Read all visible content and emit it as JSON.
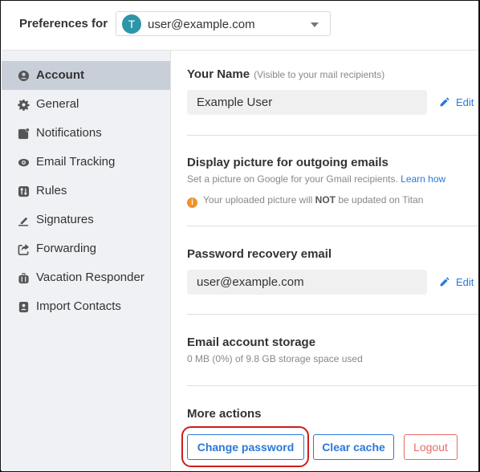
{
  "header": {
    "label": "Preferences for",
    "account": {
      "avatar_initial": "T",
      "email": "user@example.com",
      "avatar_color": "#2b96a8"
    }
  },
  "sidebar": {
    "items": [
      {
        "label": "Account",
        "icon": "user-circle-icon",
        "active": true
      },
      {
        "label": "General",
        "icon": "gear-icon",
        "active": false
      },
      {
        "label": "Notifications",
        "icon": "notification-icon",
        "active": false
      },
      {
        "label": "Email Tracking",
        "icon": "eye-icon",
        "active": false
      },
      {
        "label": "Rules",
        "icon": "rules-icon",
        "active": false
      },
      {
        "label": "Signatures",
        "icon": "pen-icon",
        "active": false
      },
      {
        "label": "Forwarding",
        "icon": "share-icon",
        "active": false
      },
      {
        "label": "Vacation Responder",
        "icon": "suitcase-icon",
        "active": false
      },
      {
        "label": "Import Contacts",
        "icon": "contact-book-icon",
        "active": false
      }
    ]
  },
  "main": {
    "name": {
      "title": "Your Name",
      "hint": "(Visible to your mail recipients)",
      "value": "Example User",
      "edit_label": "Edit"
    },
    "picture": {
      "title": "Display picture for outgoing emails",
      "description": "Set a picture on Google for your Gmail recipients.",
      "link": "Learn how",
      "info_prefix": "Your uploaded picture will",
      "info_bold": "NOT",
      "info_suffix": "be updated on Titan"
    },
    "recovery": {
      "title": "Password recovery email",
      "value": "user@example.com",
      "edit_label": "Edit"
    },
    "storage": {
      "title": "Email account storage",
      "usage": "0 MB (0%) of 9.8 GB storage space used"
    },
    "actions": {
      "title": "More actions",
      "change_password": "Change password",
      "clear_cache": "Clear cache",
      "logout": "Logout"
    }
  },
  "colors": {
    "accent": "#2a78d8",
    "danger": "#e96a6a",
    "highlight": "#cc1d1d",
    "info": "#f0922b"
  }
}
